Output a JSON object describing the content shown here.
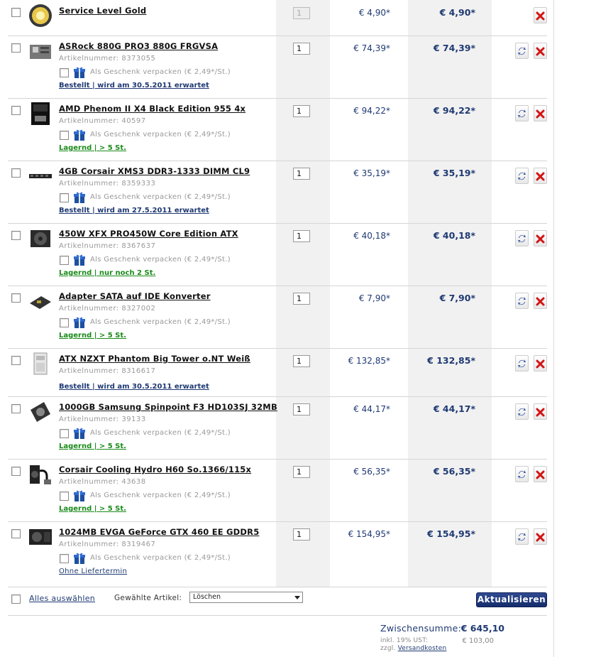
{
  "items": [
    {
      "name": "Service Level Gold",
      "artnr_label": "",
      "artnr": "",
      "gift": false,
      "status": "",
      "status_type": "",
      "qty": "1",
      "qty_disabled": true,
      "price": "€ 4,90*",
      "total": "€ 4,90*",
      "refresh": false,
      "icon": "service-gold-icon"
    },
    {
      "name": "ASRock 880G PRO3 880G FRGVSA",
      "artnr_label": "Artikelnummer:",
      "artnr": "8373055",
      "gift": true,
      "status": "Bestellt | wird am 30.5.2011 erwartet",
      "status_type": "blue",
      "qty": "1",
      "qty_disabled": false,
      "price": "€ 74,39*",
      "total": "€ 74,39*",
      "refresh": true,
      "icon": "mainboard-icon"
    },
    {
      "name": "AMD Phenom II X4 Black Edition 955 4x",
      "artnr_label": "Artikelnummer:",
      "artnr": "40597",
      "gift": true,
      "status": "Lagernd | > 5 St.",
      "status_type": "green",
      "qty": "1",
      "qty_disabled": false,
      "price": "€ 94,22*",
      "total": "€ 94,22*",
      "refresh": true,
      "icon": "cpu-box-icon"
    },
    {
      "name": "4GB Corsair XMS3 DDR3-1333 DIMM CL9",
      "artnr_label": "Artikelnummer:",
      "artnr": "8359333",
      "gift": true,
      "status": "Bestellt | wird am 27.5.2011 erwartet",
      "status_type": "blue",
      "qty": "1",
      "qty_disabled": false,
      "price": "€ 35,19*",
      "total": "€ 35,19*",
      "refresh": true,
      "icon": "ram-icon"
    },
    {
      "name": "450W XFX PRO450W Core Edition ATX",
      "artnr_label": "Artikelnummer:",
      "artnr": "8367637",
      "gift": true,
      "status": "Lagernd | nur noch 2 St.",
      "status_type": "green",
      "qty": "1",
      "qty_disabled": false,
      "price": "€ 40,18*",
      "total": "€ 40,18*",
      "refresh": true,
      "icon": "psu-icon"
    },
    {
      "name": "Adapter SATA auf IDE Konverter",
      "artnr_label": "Artikelnummer:",
      "artnr": "8327002",
      "gift": true,
      "status": "Lagernd | > 5 St.",
      "status_type": "green",
      "qty": "1",
      "qty_disabled": false,
      "price": "€ 7,90*",
      "total": "€ 7,90*",
      "refresh": true,
      "icon": "adapter-icon"
    },
    {
      "name": "ATX NZXT Phantom Big Tower o.NT Weiß",
      "artnr_label": "Artikelnummer:",
      "artnr": "8316617",
      "gift": false,
      "status": "Bestellt | wird am 30.5.2011 erwartet",
      "status_type": "blue",
      "qty": "1",
      "qty_disabled": false,
      "price": "€ 132,85*",
      "total": "€ 132,85*",
      "refresh": true,
      "icon": "tower-case-icon"
    },
    {
      "name": "1000GB Samsung Spinpoint F3 HD103SJ 32MB",
      "artnr_label": "Artikelnummer:",
      "artnr": "39133",
      "gift": true,
      "status": "Lagernd | > 5 St.",
      "status_type": "green",
      "qty": "1",
      "qty_disabled": false,
      "price": "€ 44,17*",
      "total": "€ 44,17*",
      "refresh": true,
      "icon": "hard-disk-icon"
    },
    {
      "name": "Corsair Cooling Hydro H60 So.1366/115x",
      "artnr_label": "Artikelnummer:",
      "artnr": "43638",
      "gift": true,
      "status": "Lagernd | > 5 St.",
      "status_type": "green",
      "qty": "1",
      "qty_disabled": false,
      "price": "€ 56,35*",
      "total": "€ 56,35*",
      "refresh": true,
      "icon": "water-cooler-icon"
    },
    {
      "name": "1024MB EVGA GeForce GTX 460 EE GDDR5",
      "artnr_label": "Artikelnummer:",
      "artnr": "8319467",
      "gift": true,
      "status": "Ohne Liefertermin",
      "status_type": "plain",
      "qty": "1",
      "qty_disabled": false,
      "price": "€ 154,95*",
      "total": "€ 154,95*",
      "refresh": true,
      "icon": "graphics-card-icon"
    }
  ],
  "gift_label": "Als Geschenk verpacken (€ 2,49*/St.)",
  "footer": {
    "select_all": "Alles auswählen",
    "selected_label": "Gewählte Artikel:",
    "action_value": "Löschen",
    "update_button": "Aktualisieren"
  },
  "summary": {
    "subtotal_label": "Zwischensumme:",
    "subtotal_value": "€ 645,10",
    "vat_label": "inkl. 19% UST:",
    "shipping_prefix": "zzgl.",
    "shipping_link": "Versandkosten",
    "vat_value": "€ 103,00"
  },
  "colors": {
    "accent": "#1f3a73",
    "in_stock": "#1a8a1a",
    "delete": "#d41515",
    "refresh": "#2a4d9b"
  }
}
